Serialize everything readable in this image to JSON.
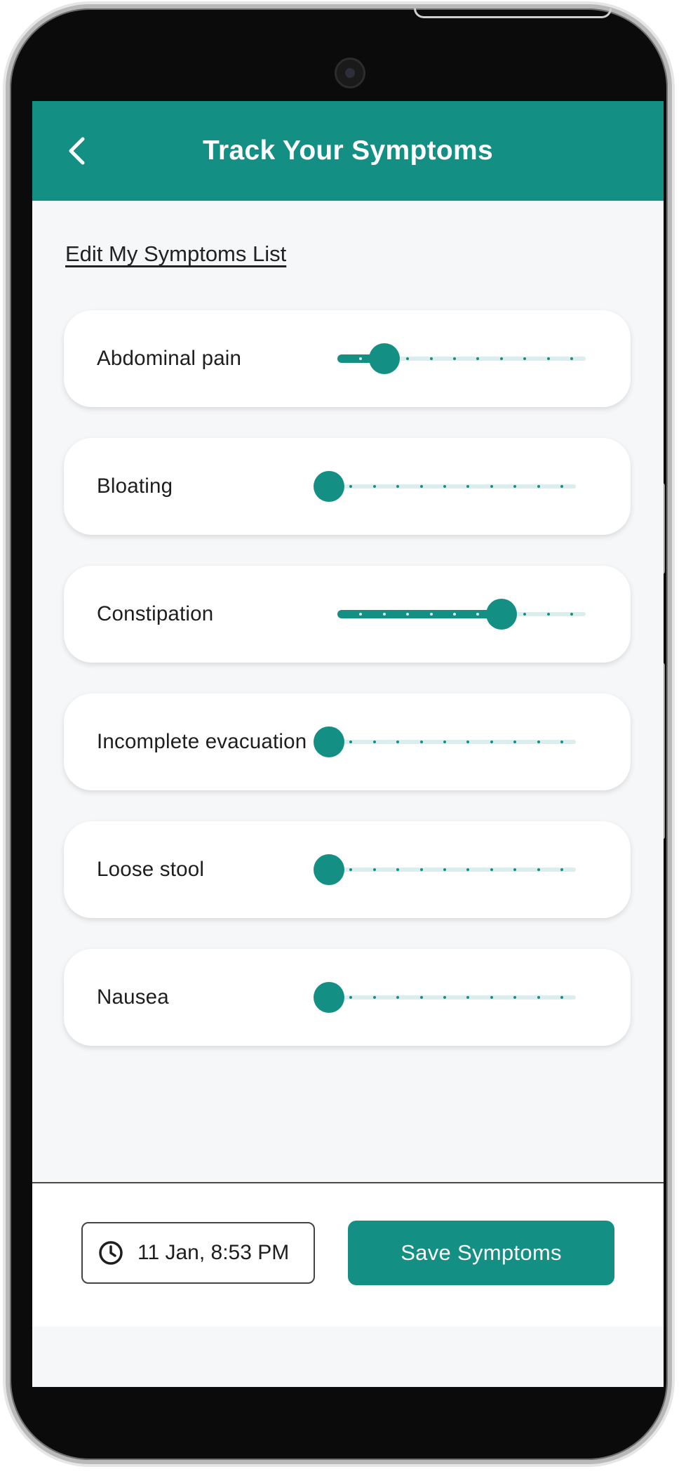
{
  "colors": {
    "accent": "#138f84",
    "track": "#dbeeed",
    "screen_bg": "#f6f7f9"
  },
  "header": {
    "title": "Track Your Symptoms",
    "back_icon": "chevron-left-icon"
  },
  "edit_link": "Edit My Symptoms List",
  "slider_max": 10,
  "symptoms": [
    {
      "label": "Abdominal pain",
      "value": 2
    },
    {
      "label": "Bloating",
      "value": 0
    },
    {
      "label": "Constipation",
      "value": 7
    },
    {
      "label": "Incomplete evacuation",
      "value": 0
    },
    {
      "label": "Loose stool",
      "value": 0
    },
    {
      "label": "Nausea",
      "value": 0
    }
  ],
  "footer": {
    "datetime": "11 Jan, 8:53 PM",
    "clock_icon": "clock-icon",
    "save_label": "Save Symptoms"
  }
}
